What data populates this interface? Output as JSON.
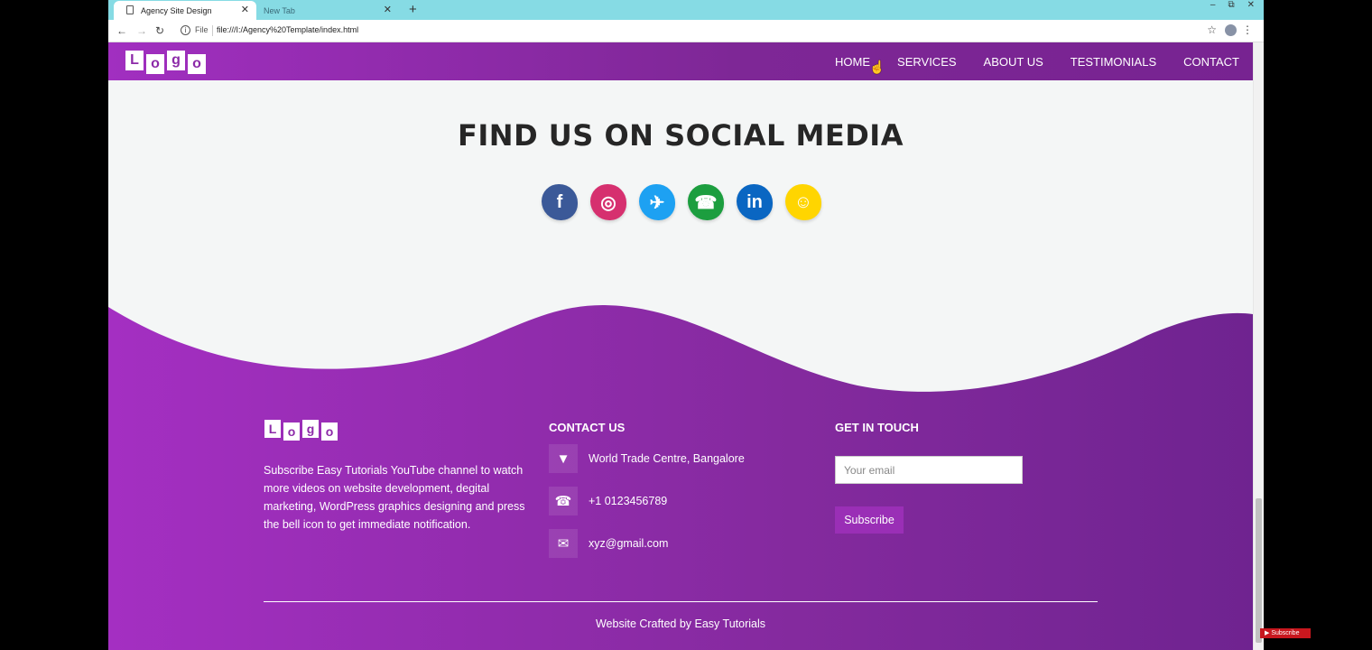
{
  "browser": {
    "tabs": [
      {
        "title": "Agency Site Design",
        "active": true
      },
      {
        "title": "New Tab",
        "active": false
      }
    ],
    "new_tab_icon": "+",
    "window_controls": [
      "–",
      "⧉",
      "✕"
    ],
    "address": {
      "scheme_label": "File",
      "url": "file:///I:/Agency%20Template/index.html"
    }
  },
  "header": {
    "logo_letters": [
      "L",
      "o",
      "g",
      "o"
    ],
    "nav": [
      "HOME",
      "SERVICES",
      "ABOUT US",
      "TESTIMONIALS",
      "CONTACT"
    ]
  },
  "social": {
    "title": "FIND US ON SOCIAL MEDIA",
    "icons": [
      {
        "name": "facebook-icon",
        "glyph": "f",
        "color": "#3b5998"
      },
      {
        "name": "instagram-icon",
        "glyph": "◎",
        "color": "#d6306f"
      },
      {
        "name": "twitter-icon",
        "glyph": "✈",
        "color": "#1da1f2"
      },
      {
        "name": "whatsapp-icon",
        "glyph": "☎",
        "color": "#1c9e3f"
      },
      {
        "name": "linkedin-icon",
        "glyph": "in",
        "color": "#0a66c2"
      },
      {
        "name": "snapchat-icon",
        "glyph": "☺",
        "color": "#ffd500"
      }
    ]
  },
  "footer": {
    "about_text": "Subscribe Easy Tutorials YouTube channel to watch more videos on website development, degital marketing, WordPress graphics designing and press the bell icon to get immediate notification.",
    "contact_title": "CONTACT US",
    "contact": [
      {
        "icon": "location-pin-icon",
        "glyph": "▼",
        "text": "World Trade Centre, Bangalore"
      },
      {
        "icon": "phone-icon",
        "glyph": "☎",
        "text": "+1 0123456789"
      },
      {
        "icon": "envelope-icon",
        "glyph": "✉",
        "text": "xyz@gmail.com"
      }
    ],
    "touch_title": "GET IN TOUCH",
    "email_placeholder": "Your email",
    "subscribe_label": "Subscribe",
    "credit": "Website Crafted by Easy Tutorials"
  },
  "overlay": {
    "yt_badge": "▶ Subscribe"
  },
  "colors": {
    "purple_light": "#a12fc0",
    "purple_dark": "#772391",
    "page_bg": "#f4f6f6"
  }
}
